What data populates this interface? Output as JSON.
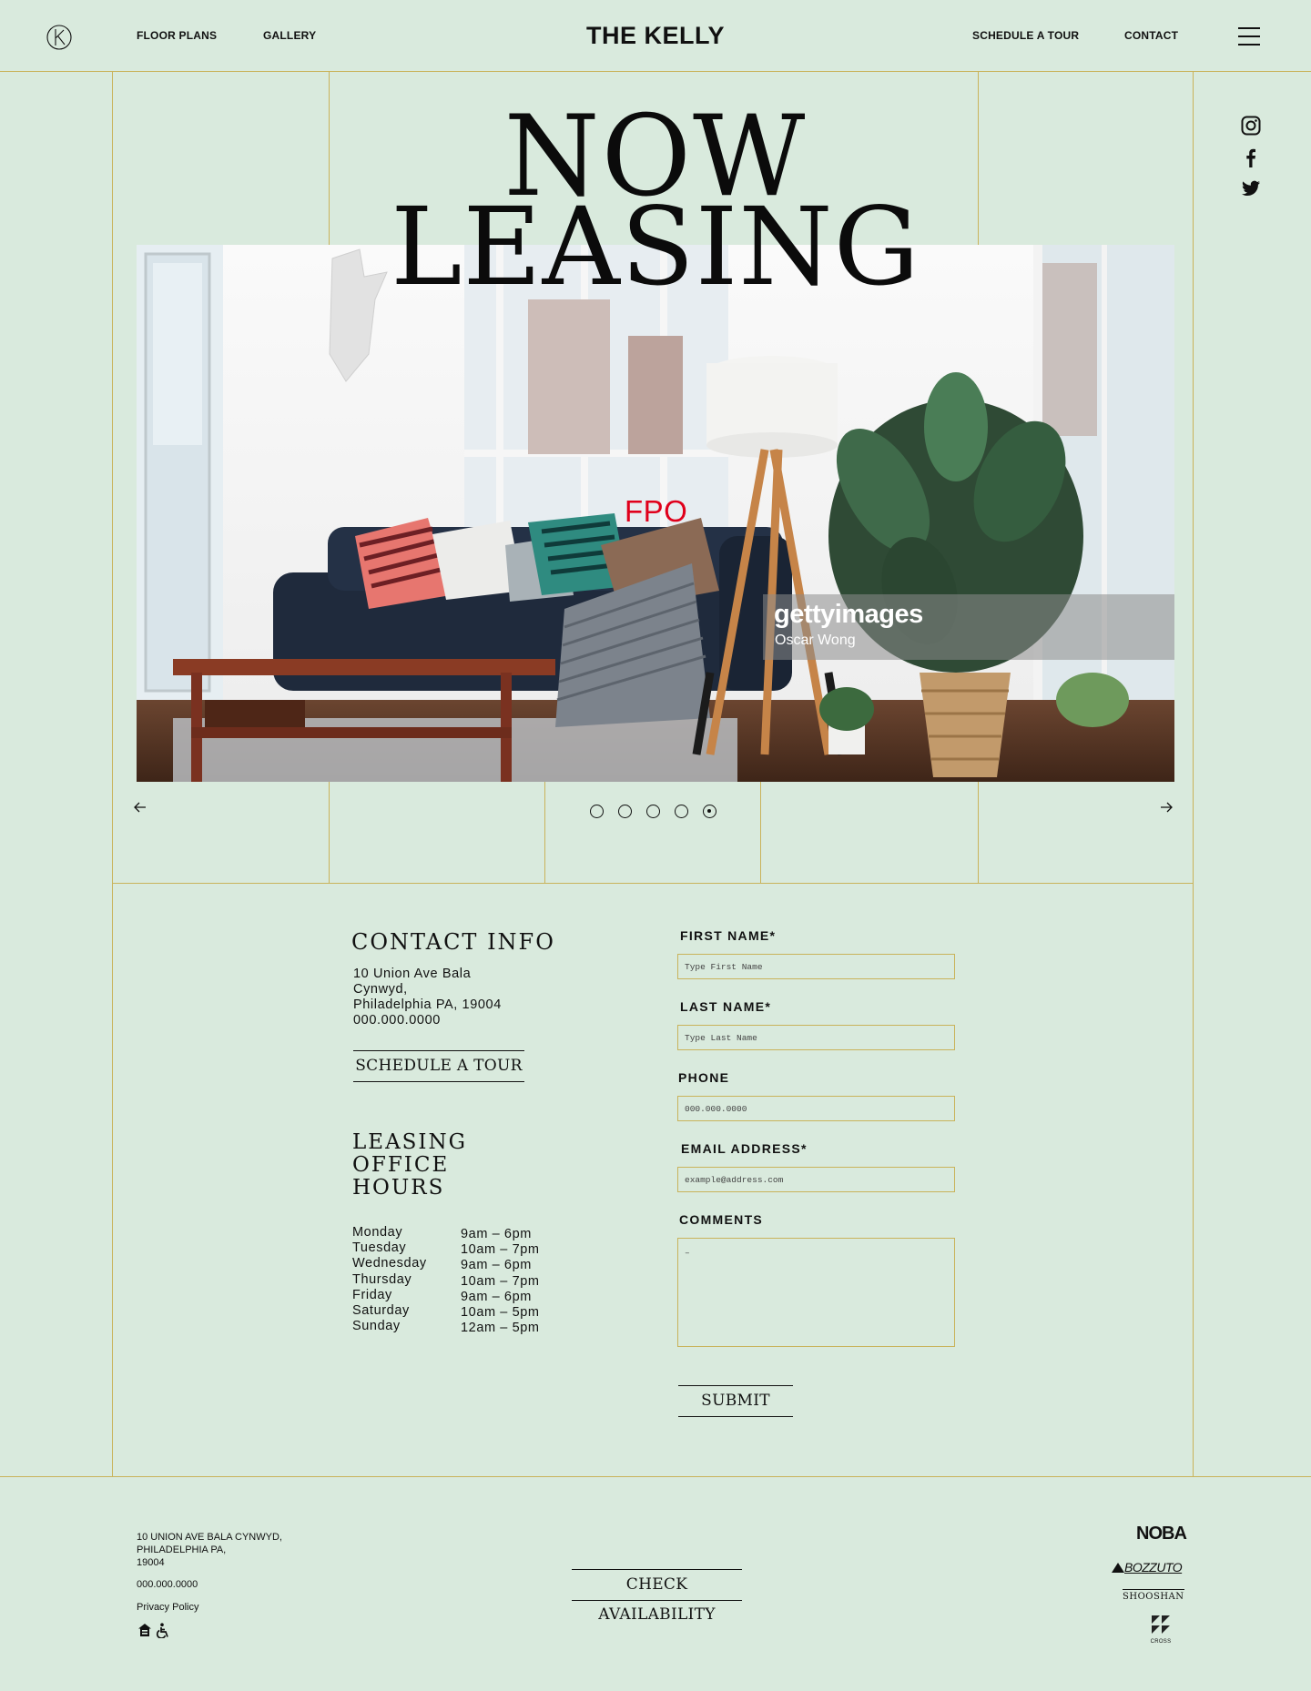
{
  "header": {
    "nav_left": [
      "FLOOR PLANS",
      "GALLERY"
    ],
    "brand": "THE KELLY",
    "nav_right": [
      "SCHEDULE A TOUR",
      "CONTACT"
    ]
  },
  "hero": {
    "title_line1": "NOW",
    "title_line2": "LEASING",
    "photo_overlay": "FPO",
    "watermark_brand": "gettyimages",
    "watermark_credit": "Oscar Wong",
    "slide_count": 5,
    "active_slide": 5
  },
  "contact": {
    "heading": "CONTACT INFO",
    "address_lines": [
      "10 Union Ave Bala",
      "Cynwyd,",
      "Philadelphia PA, 19004",
      "000.000.0000"
    ],
    "schedule_button": "SCHEDULE A TOUR",
    "hours_heading": [
      "LEASING",
      "OFFICE",
      "HOURS"
    ],
    "hours": [
      {
        "day": "Monday",
        "time": "9am – 6pm"
      },
      {
        "day": "Tuesday",
        "time": "10am – 7pm"
      },
      {
        "day": "Wednesday",
        "time": "9am – 6pm"
      },
      {
        "day": "Thursday",
        "time": "10am – 7pm"
      },
      {
        "day": "Friday",
        "time": "9am – 6pm"
      },
      {
        "day": "Saturday",
        "time": "10am – 5pm"
      },
      {
        "day": "Sunday",
        "time": "12am – 5pm"
      }
    ]
  },
  "form": {
    "first_name_label": "FIRST NAME*",
    "first_name_placeholder": "Type First Name",
    "last_name_label": "LAST NAME*",
    "last_name_placeholder": "Type Last Name",
    "phone_label": "PHONE",
    "phone_placeholder": "000.000.0000",
    "email_label": "EMAIL ADDRESS*",
    "email_placeholder": "example@address.com",
    "comments_label": "COMMENTS",
    "comments_placeholder": "–",
    "submit_label": "SUBMIT"
  },
  "footer": {
    "address_lines": [
      "10 UNION AVE BALA CYNWYD,",
      "PHILADELPHIA PA,",
      "19004"
    ],
    "phone": "000.000.0000",
    "privacy": "Privacy Policy",
    "cta": "CHECK AVAILABILITY",
    "partners": [
      "NOBA",
      "BOZZUTO",
      "SHOOSHAN",
      "CROSS"
    ]
  },
  "colors": {
    "background": "#d9eadd",
    "rule": "#c9b35a",
    "fpo_text": "#e0001b"
  }
}
